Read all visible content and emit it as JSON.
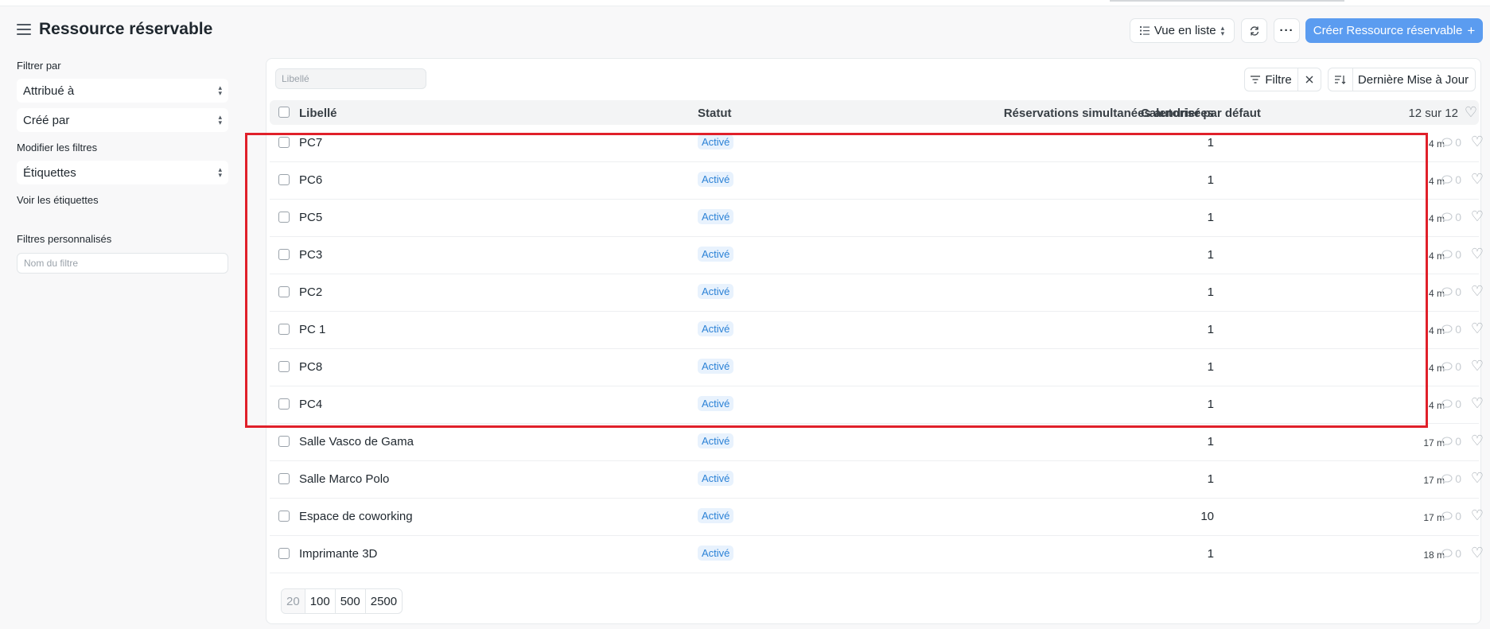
{
  "header": {
    "title": "Ressource réservable",
    "view_label": "Vue en liste",
    "more_label": "···",
    "create_label": "Créer Ressource réservable"
  },
  "sidebar": {
    "filter_by_label": "Filtrer par",
    "assigned_to": "Attribué à",
    "created_by": "Créé par",
    "edit_filters_label": "Modifier les filtres",
    "tags": "Étiquettes",
    "show_tags_label": "Voir les étiquettes",
    "custom_filters_label": "Filtres personnalisés",
    "filter_name_placeholder": "Nom du filtre"
  },
  "toolbar": {
    "libelle_placeholder": "Libellé",
    "filter_label": "Filtre",
    "sort_label": "Dernière Mise à Jour"
  },
  "table": {
    "columns": {
      "name": "Libellé",
      "status": "Statut",
      "concurrent": "Réservations simultanées autorisées",
      "calendar": "Calendrier par défaut"
    },
    "count_text": "12 sur 12",
    "rows": [
      {
        "name": "PC7",
        "status": "Activé",
        "concurrent": "1",
        "ago": "4 m",
        "comments": "0"
      },
      {
        "name": "PC6",
        "status": "Activé",
        "concurrent": "1",
        "ago": "4 m",
        "comments": "0"
      },
      {
        "name": "PC5",
        "status": "Activé",
        "concurrent": "1",
        "ago": "4 m",
        "comments": "0"
      },
      {
        "name": "PC3",
        "status": "Activé",
        "concurrent": "1",
        "ago": "4 m",
        "comments": "0"
      },
      {
        "name": "PC2",
        "status": "Activé",
        "concurrent": "1",
        "ago": "4 m",
        "comments": "0"
      },
      {
        "name": "PC 1",
        "status": "Activé",
        "concurrent": "1",
        "ago": "4 m",
        "comments": "0"
      },
      {
        "name": "PC8",
        "status": "Activé",
        "concurrent": "1",
        "ago": "4 m",
        "comments": "0"
      },
      {
        "name": "PC4",
        "status": "Activé",
        "concurrent": "1",
        "ago": "4 m",
        "comments": "0"
      },
      {
        "name": "Salle Vasco de Gama",
        "status": "Activé",
        "concurrent": "1",
        "ago": "17 m",
        "comments": "0"
      },
      {
        "name": "Salle Marco Polo",
        "status": "Activé",
        "concurrent": "1",
        "ago": "17 m",
        "comments": "0"
      },
      {
        "name": "Espace de coworking",
        "status": "Activé",
        "concurrent": "10",
        "ago": "17 m",
        "comments": "0"
      },
      {
        "name": "Imprimante 3D",
        "status": "Activé",
        "concurrent": "1",
        "ago": "18 m",
        "comments": "0"
      }
    ]
  },
  "pagination": {
    "sizes": [
      "20",
      "100",
      "500",
      "2500"
    ],
    "active": "20"
  },
  "colors": {
    "accent": "#5b9cf0",
    "status_bg": "#e8f2fd",
    "status_text": "#2c82d6",
    "highlight": "#e0202a"
  },
  "icons": {
    "menu": "hamburger-icon",
    "list": "list-icon",
    "refresh": "refresh-icon",
    "plus": "plus-icon",
    "filter": "filter-icon",
    "close": "close-icon",
    "sort": "sort-icon",
    "comment": "comment-icon",
    "heart": "heart-icon"
  }
}
